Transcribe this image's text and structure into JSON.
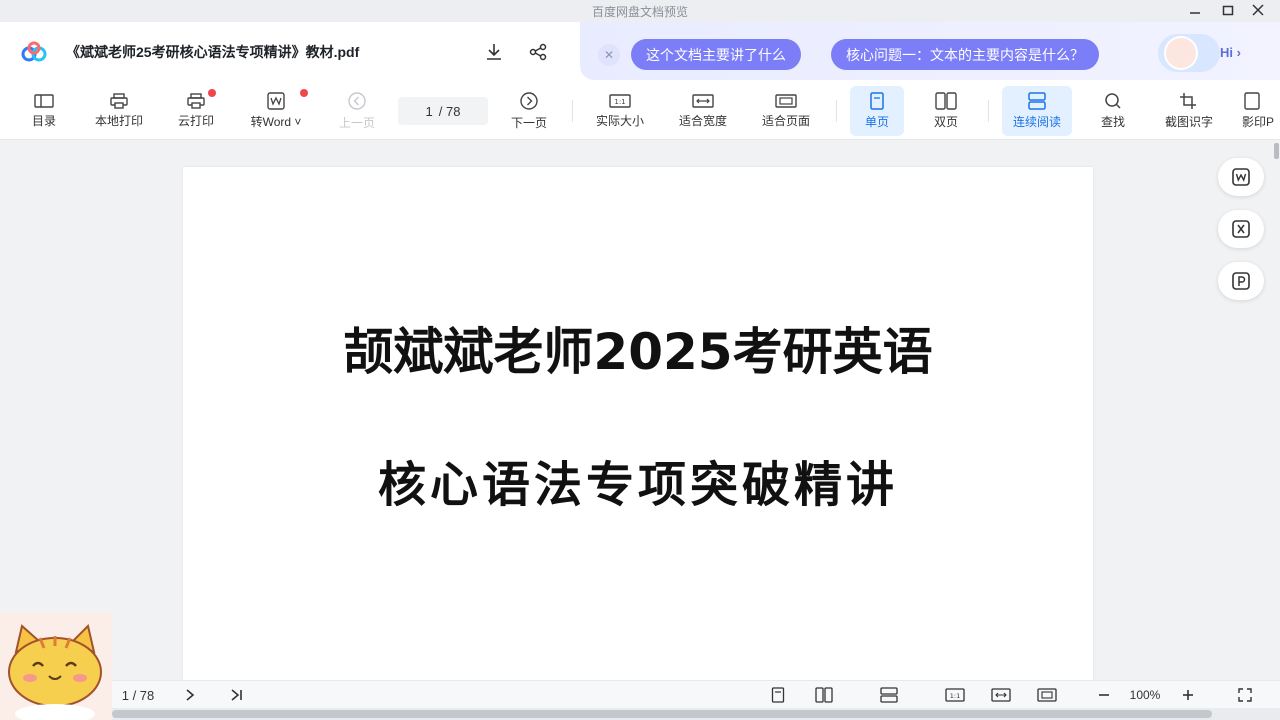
{
  "window": {
    "title": "百度网盘文档预览"
  },
  "header": {
    "doc_title": "《斌斌老师25考研核心语法专项精讲》教材.pdf",
    "ai": {
      "chips": [
        "这个文档主要讲了什么",
        "核心问题一：文本的主要内容是什么？"
      ],
      "hi_label": "Hi ›"
    }
  },
  "toolbar": {
    "toc": "目录",
    "local_print": "本地打印",
    "cloud_print": "云打印",
    "to_word": "转Word ˅",
    "prev_page": "上一页",
    "page_current": "1",
    "page_total": "/ 78",
    "next_page": "下一页",
    "actual_size": "实际大小",
    "fit_width": "适合宽度",
    "fit_page": "适合页面",
    "single_page": "单页",
    "double_page": "双页",
    "continuous": "连续阅读",
    "find": "查找",
    "screenshot_ocr": "截图识字",
    "shadow_print": "影印P"
  },
  "document": {
    "heading_line1": "颉斌斌老师2025考研英语",
    "heading_line2": "核心语法专项突破精讲"
  },
  "statusbar": {
    "page_indicator": "1 / 78",
    "zoom": "100%"
  },
  "colors": {
    "accent": "#1a73e8",
    "ai_chip": "#7b7ef7",
    "badge": "#f0454d"
  }
}
